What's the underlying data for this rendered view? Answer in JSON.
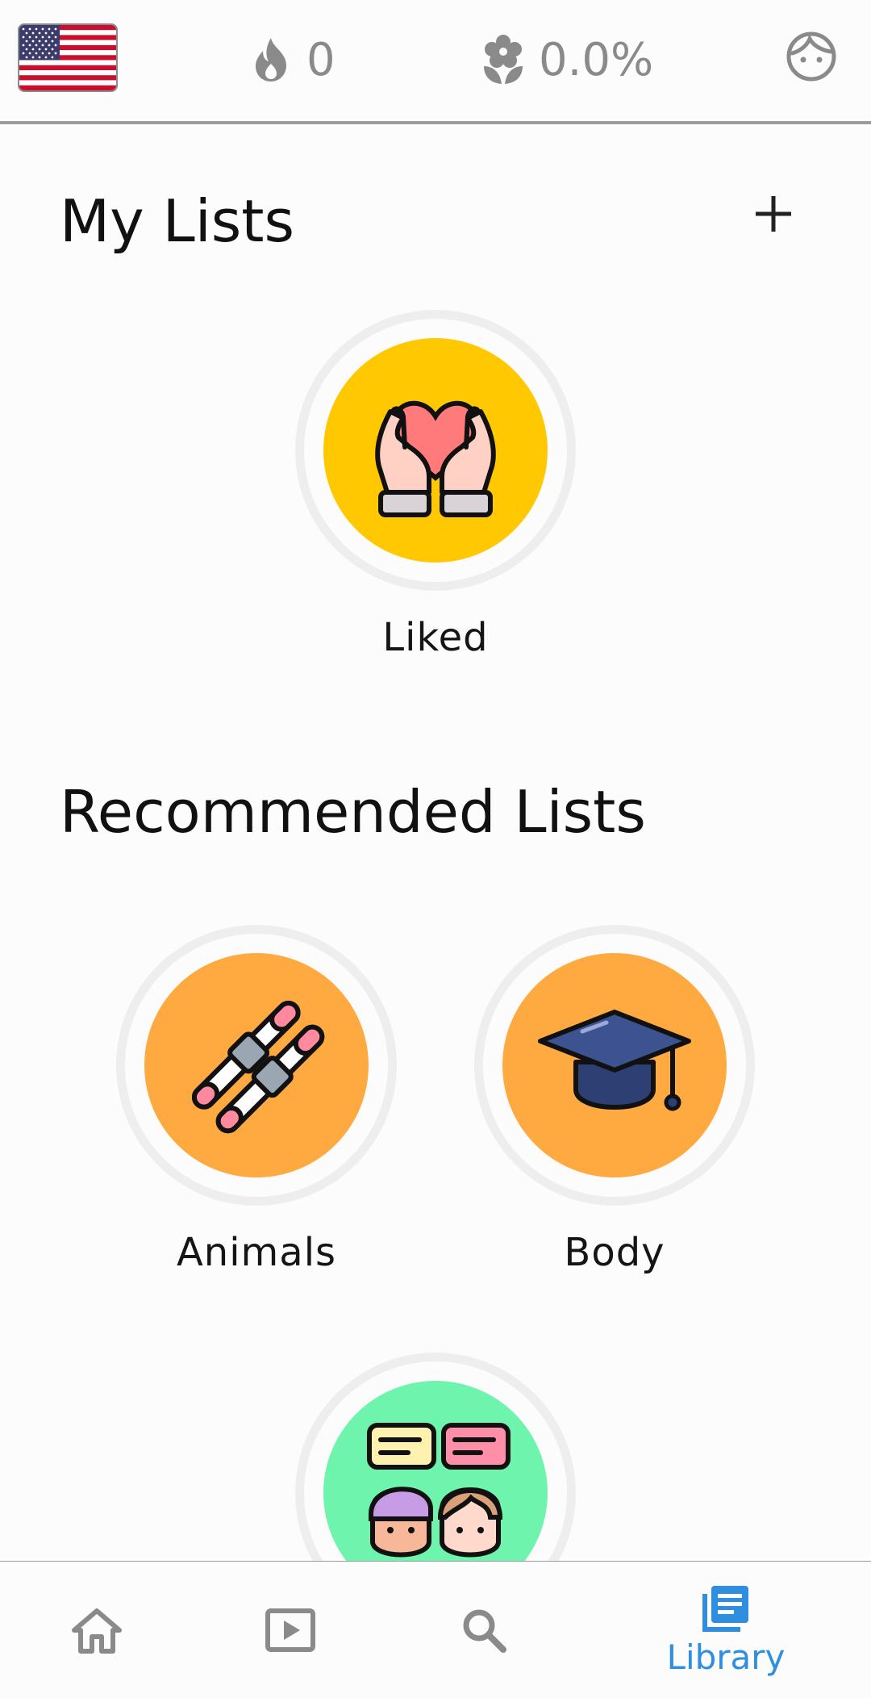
{
  "header": {
    "streak_value": "0",
    "progress_value": "0.0%"
  },
  "my_lists": {
    "title": "My Lists",
    "items": [
      {
        "label": "Liked",
        "icon": "heart-in-hands-icon",
        "color": "#ffc800"
      }
    ]
  },
  "recommended_lists": {
    "title": "Recommended Lists",
    "items": [
      {
        "label": "Animals",
        "icon": "skis-icon",
        "color": "#ffaa40"
      },
      {
        "label": "Body",
        "icon": "graduation-cap-icon",
        "color": "#ffaa40"
      },
      {
        "label": "",
        "icon": "conversation-people-icon",
        "color": "#6ef4ad"
      }
    ]
  },
  "bottom_nav": {
    "items": [
      {
        "icon": "home-icon"
      },
      {
        "icon": "video-icon"
      },
      {
        "icon": "search-icon"
      },
      {
        "icon": "library-icon",
        "label": "Library",
        "active": true
      }
    ]
  },
  "colors": {
    "accent": "#2f8ee0",
    "muted": "#8a8a8a"
  }
}
